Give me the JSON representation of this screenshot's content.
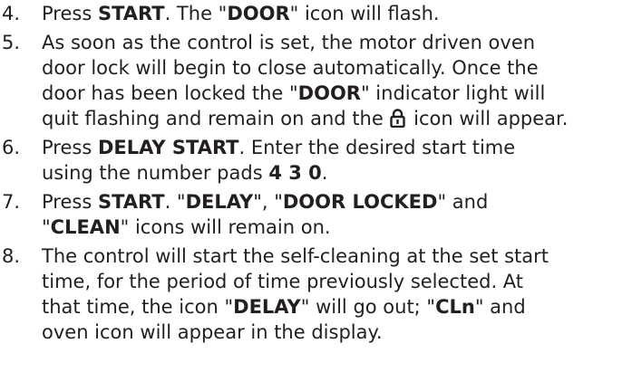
{
  "steps": [
    {
      "number": "4.",
      "lines": [
        [
          {
            "t": "Press "
          },
          {
            "t": "START",
            "b": true
          },
          {
            "t": ". The \""
          },
          {
            "t": "DOOR",
            "b": true
          },
          {
            "t": "\" icon will flash."
          }
        ]
      ]
    },
    {
      "number": "5.",
      "lines": [
        [
          {
            "t": "As soon as the control is set, the motor driven oven"
          }
        ],
        [
          {
            "t": "door lock will begin to close automatically. Once the"
          }
        ],
        [
          {
            "t": "door has been locked the \""
          },
          {
            "t": "DOOR",
            "b": true
          },
          {
            "t": "\" indicator light will"
          }
        ],
        [
          {
            "t": "quit flashing and remain on and the "
          },
          {
            "icon": "lock-icon"
          },
          {
            "t": " icon will appear."
          }
        ]
      ]
    },
    {
      "number": "6.",
      "lines": [
        [
          {
            "t": "Press "
          },
          {
            "t": "DELAY START",
            "b": true
          },
          {
            "t": ". Enter the desired start time"
          }
        ],
        [
          {
            "t": "using the number pads "
          },
          {
            "t": "4 3 0",
            "b": true
          },
          {
            "t": "."
          }
        ]
      ]
    },
    {
      "number": "7.",
      "lines": [
        [
          {
            "t": "Press "
          },
          {
            "t": "START",
            "b": true
          },
          {
            "t": ". \""
          },
          {
            "t": "DELAY",
            "b": true
          },
          {
            "t": "\", \""
          },
          {
            "t": "DOOR LOCKED",
            "b": true
          },
          {
            "t": "\" and"
          }
        ],
        [
          {
            "t": "\""
          },
          {
            "t": "CLEAN",
            "b": true
          },
          {
            "t": "\" icons will remain on."
          }
        ]
      ]
    },
    {
      "number": "8.",
      "lines": [
        [
          {
            "t": "The control will start the self-cleaning at the set start"
          }
        ],
        [
          {
            "t": "time, for the period of time previously selected. At"
          }
        ],
        [
          {
            "t": "that time, the icon \""
          },
          {
            "t": "DELAY",
            "b": true
          },
          {
            "t": "\" will go out; \""
          },
          {
            "t": "CLn",
            "b": true
          },
          {
            "t": "\" and"
          }
        ],
        [
          {
            "t": "oven icon will appear in the display."
          }
        ]
      ]
    }
  ]
}
